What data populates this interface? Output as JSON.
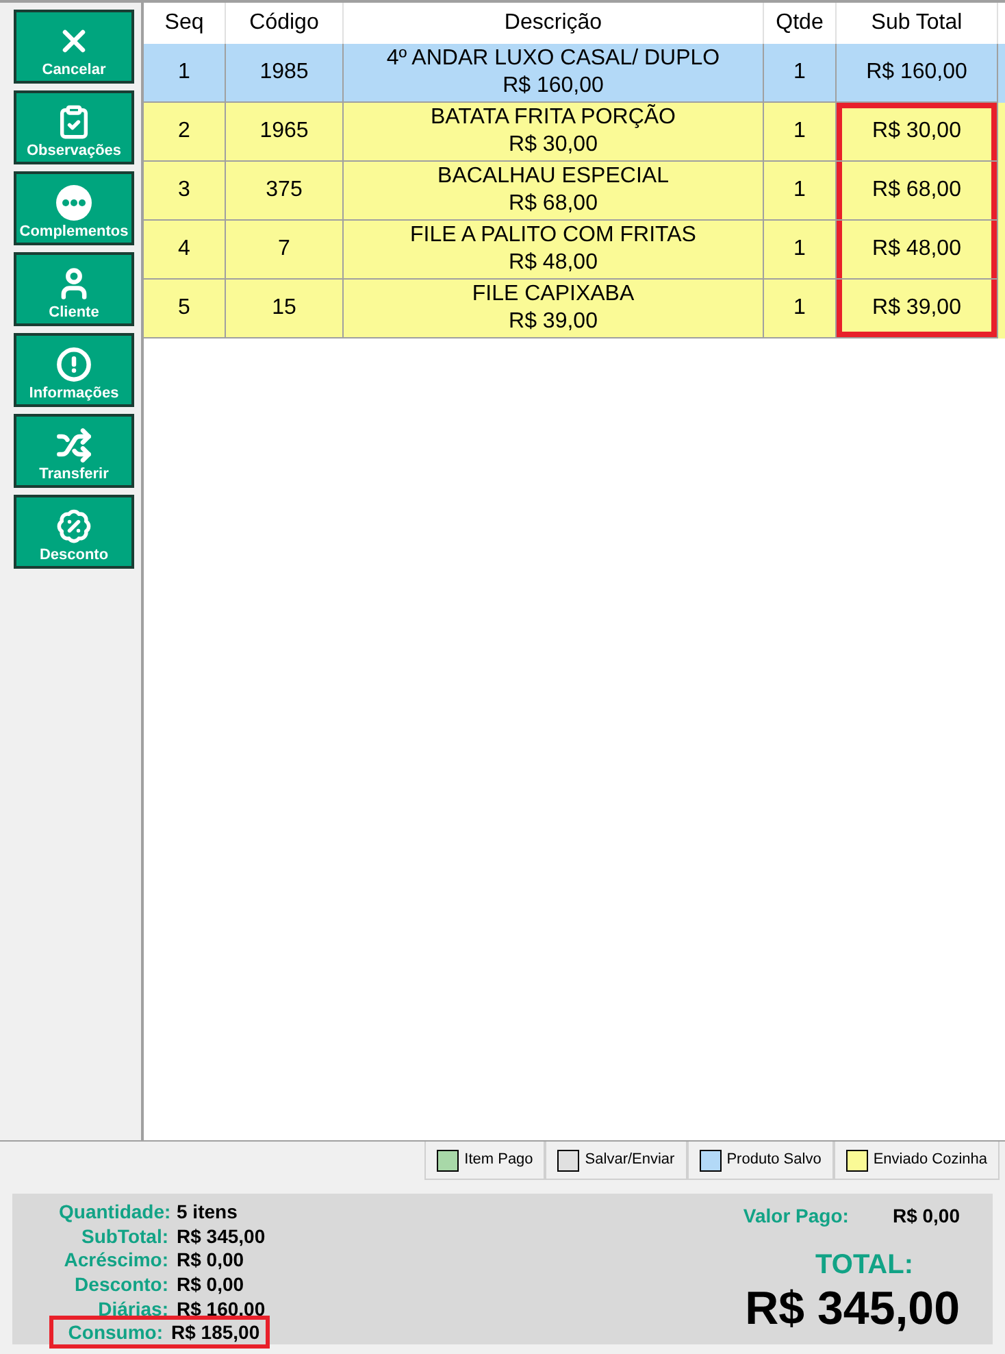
{
  "sidebar": {
    "buttons": [
      {
        "label": "Cancelar",
        "kind": "close"
      },
      {
        "label": "Observações",
        "kind": "clipboard"
      },
      {
        "label": "Complementos",
        "kind": "dots"
      },
      {
        "label": "Cliente",
        "kind": "person"
      },
      {
        "label": "Informações",
        "kind": "alert"
      },
      {
        "label": "Transferir",
        "kind": "shuffle"
      },
      {
        "label": "Desconto",
        "kind": "discount"
      }
    ]
  },
  "table": {
    "columns": [
      "Seq",
      "Código",
      "Descrição",
      "Qtde",
      "Sub Total"
    ],
    "rows": [
      {
        "seq": "1",
        "code": "1985",
        "description": "4º ANDAR LUXO CASAL/ DUPLO",
        "price": "R$ 160,00",
        "qty": "1",
        "subtotal": "R$ 160,00",
        "color": "#b3d9f7",
        "marked": false
      },
      {
        "seq": "2",
        "code": "1965",
        "description": "BATATA FRITA PORÇÃO",
        "price": "R$ 30,00",
        "qty": "1",
        "subtotal": "R$ 30,00",
        "color": "#fafa96",
        "marked": true
      },
      {
        "seq": "3",
        "code": "375",
        "description": "BACALHAU ESPECIAL",
        "price": "R$ 68,00",
        "qty": "1",
        "subtotal": "R$ 68,00",
        "color": "#fafa96",
        "marked": true
      },
      {
        "seq": "4",
        "code": "7",
        "description": "FILE A PALITO COM FRITAS",
        "price": "R$ 48,00",
        "qty": "1",
        "subtotal": "R$ 48,00",
        "color": "#fafa96",
        "marked": true
      },
      {
        "seq": "5",
        "code": "15",
        "description": "FILE CAPIXABA",
        "price": "R$ 39,00",
        "qty": "1",
        "subtotal": "R$ 39,00",
        "color": "#fafa96",
        "marked": true
      }
    ]
  },
  "legend": [
    {
      "label": "Item Pago",
      "color": "#a8d8a8"
    },
    {
      "label": "Salvar/Enviar",
      "color": "#e0e0e0"
    },
    {
      "label": "Produto Salvo",
      "color": "#b3d9f7"
    },
    {
      "label": "Enviado Cozinha",
      "color": "#fafa96"
    }
  ],
  "summary": {
    "lines": [
      {
        "label": "Quantidade:",
        "value": "5 itens",
        "marked": false
      },
      {
        "label": "SubTotal:",
        "value": "R$ 345,00",
        "marked": false
      },
      {
        "label": "Acréscimo:",
        "value": "R$ 0,00",
        "marked": false
      },
      {
        "label": "Desconto:",
        "value": "R$ 0,00",
        "marked": false
      },
      {
        "label": "Diárias:",
        "value": "R$ 160,00",
        "marked": false
      },
      {
        "label": "Consumo:",
        "value": "R$ 185,00",
        "marked": true
      }
    ],
    "paid_label": "Valor Pago:",
    "paid_value": "R$ 0,00",
    "total_label": "TOTAL:",
    "total_value": "R$ 345,00"
  }
}
